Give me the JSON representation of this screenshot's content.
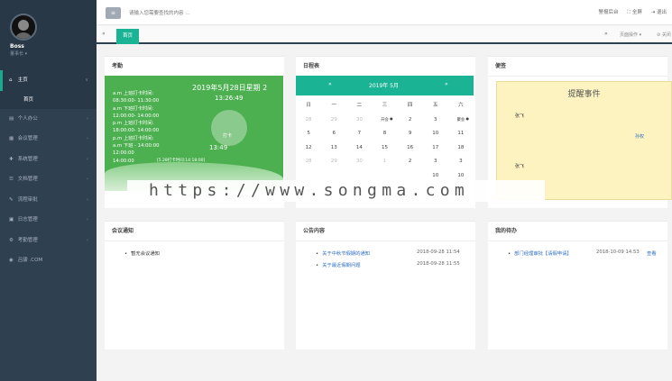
{
  "user": {
    "name": "Boss",
    "role": "董事长 ▾"
  },
  "sidebar": {
    "items": [
      {
        "icon": "⌂",
        "label": "主页",
        "active": true
      },
      {
        "icon": "▤",
        "label": "个人办公"
      },
      {
        "icon": "▦",
        "label": "会议管理"
      },
      {
        "icon": "✚",
        "label": "系统管理"
      },
      {
        "icon": "☰",
        "label": "文档管理"
      },
      {
        "icon": "✎",
        "label": "流程审批"
      },
      {
        "icon": "▣",
        "label": "日志管理"
      },
      {
        "icon": "⚙",
        "label": "考勤管理"
      },
      {
        "icon": "◉",
        "label": "吕骏 .COM"
      }
    ],
    "sub_item": "首页"
  },
  "topbar": {
    "menu_icon": "≡",
    "search_placeholder": "请输入您需要查找的内容 …",
    "actions": [
      "警报后台",
      "⛶ 全屏",
      "⇥ 退出"
    ]
  },
  "tabs": {
    "left_arrow": "«",
    "active": "首页",
    "right_arrow": "»",
    "ops": "页面操作 ▾",
    "close": "⊘ 关闭"
  },
  "attendance": {
    "title": "考勤",
    "date": "2019年5月28日星期 2",
    "time": "13:26:49",
    "lines": [
      "a.m 上班打卡时间:",
      "08:30:00- 11:30:00",
      "a.m 下班打卡时间:",
      "12:00:00- 14:00:00",
      "p.m 上班打卡时间:",
      "18:00:00- 14:00:00",
      "p.m 上班打卡时间:",
      "a.m 下班 - 14:00:00",
      "12:00:00",
      "14:00:00"
    ],
    "circle_text": "打卡",
    "time2": "13:49",
    "small": "[5.28打卡时间:14:18:00]"
  },
  "calendar": {
    "title": "日程表",
    "prev": "«",
    "month": "2019年 5月",
    "next": "»",
    "weekdays": [
      "日",
      "一",
      "二",
      "三",
      "四",
      "五",
      "六"
    ],
    "rows": [
      [
        {
          "d": "28",
          "dim": true
        },
        {
          "d": "29",
          "dim": true
        },
        {
          "d": "30",
          "dim": true
        },
        {
          "d": "开会",
          "ev": true,
          "mark": "●"
        },
        {
          "d": "2"
        },
        {
          "d": "3"
        },
        {
          "d": "聚会",
          "ev": true,
          "mark": "●"
        }
      ],
      [
        {
          "d": "5"
        },
        {
          "d": "6"
        },
        {
          "d": "7"
        },
        {
          "d": "8"
        },
        {
          "d": "9"
        },
        {
          "d": "10"
        },
        {
          "d": "11"
        }
      ],
      [
        {
          "d": "12"
        },
        {
          "d": "13"
        },
        {
          "d": "14"
        },
        {
          "d": "15"
        },
        {
          "d": "16"
        },
        {
          "d": "17"
        },
        {
          "d": "18"
        }
      ],
      [
        {
          "d": "28",
          "dim": true
        },
        {
          "d": "29",
          "dim": true
        },
        {
          "d": "30",
          "dim": true
        },
        {
          "d": "1",
          "dim": true
        },
        {
          "d": "2"
        },
        {
          "d": "3"
        },
        {
          "d": "3"
        }
      ],
      [
        {
          "d": ""
        },
        {
          "d": ""
        },
        {
          "d": ""
        },
        {
          "d": ""
        },
        {
          "d": ""
        },
        {
          "d": "10"
        },
        {
          "d": "10"
        }
      ]
    ]
  },
  "memo": {
    "title": "便签",
    "heading": "提醒事件",
    "tags": [
      "张飞",
      "孙权",
      "张飞"
    ]
  },
  "meetings": {
    "title": "会议通知",
    "items": [
      "暂无会议通知"
    ]
  },
  "notices": {
    "title": "公告内容",
    "items": [
      {
        "text": "关于中秋节假期的通知",
        "date": "2018-09-28 11:54"
      },
      {
        "text": "关于最近假期问题",
        "date": "2018-09-28 11:55"
      }
    ]
  },
  "todo": {
    "title": "我的待办",
    "items": [
      {
        "text": "部门经理审批【请假申请】",
        "date": "2018-10-09 14:53",
        "action": "查看"
      }
    ]
  },
  "watermark": "https://www.songma.com",
  "colors": {
    "sidebar": "#2f4050",
    "accent": "#1ab394",
    "attendance": "#4caf50",
    "memo": "#fcf3c0"
  }
}
